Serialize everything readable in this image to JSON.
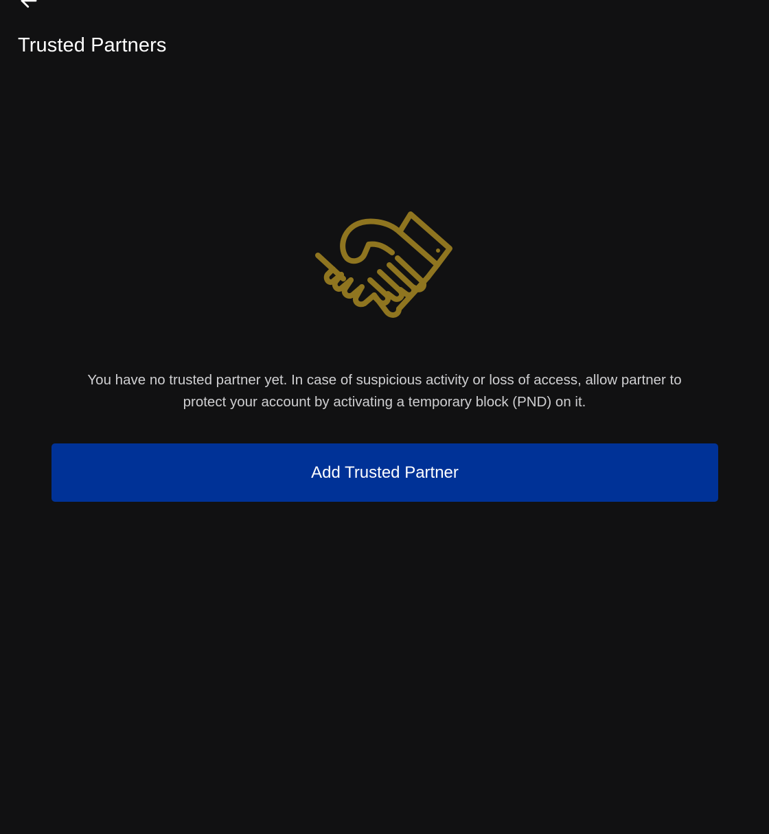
{
  "header": {
    "back_icon": "arrow-left-icon",
    "title": "Trusted Partners"
  },
  "empty_state": {
    "illustration_icon": "handshake-icon",
    "message": "You have no trusted partner yet. In case of suspicious activity or loss of access, allow partner to protect your account by activating a temporary block (PND) on it.",
    "add_button_label": "Add Trusted Partner"
  },
  "colors": {
    "background": "#111112",
    "accent_gold": "#8f7520",
    "primary_button": "#003297",
    "text_primary": "#ffffff",
    "text_secondary": "#cfcfd1"
  }
}
